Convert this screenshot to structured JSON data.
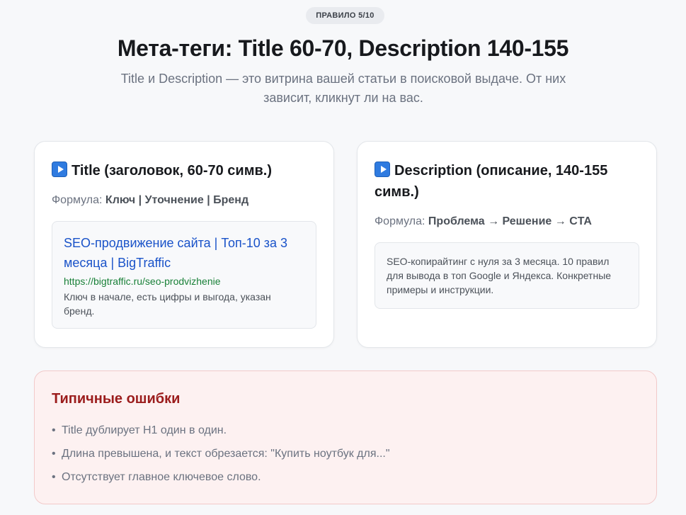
{
  "badge": "ПРАВИЛО 5/10",
  "header": {
    "title": "Мета-теги: Title 60-70, Description 140-155",
    "subtitle": "Title и Description — это витрина вашей статьи в поисковой выдаче. От них зависит, кликнут ли на вас."
  },
  "title_card": {
    "icon": "play-icon",
    "heading": "Title (заголовок, 60-70 симв.)",
    "formula_label": "Формула:",
    "formula_value": "Ключ | Уточнение | Бренд",
    "serp": {
      "title": "SEO-продвижение сайта | Топ-10 за 3 месяца | BigTraffic",
      "url": "https://bigtraffic.ru/seo-prodvizhenie",
      "note": "Ключ в начале, есть цифры и выгода, указан бренд."
    }
  },
  "description_card": {
    "icon": "play-icon",
    "heading": "Description (описание, 140-155 симв.)",
    "formula_label": "Формула:",
    "formula_value": "Проблема → Решение → CTA",
    "example": "SEO-копирайтинг с нуля за 3 месяца. 10 правил для вывода в топ Google и Яндекса. Конкретные примеры и инструкции."
  },
  "errors": {
    "title": "Типичные ошибки",
    "items": [
      "Title дублирует H1 один в один.",
      "Длина превышена, и текст обрезается: \"Купить ноутбук для...\"",
      "Отсутствует главное ключевое слово."
    ]
  },
  "colors": {
    "accent_link": "#1a53c9",
    "url_green": "#198038",
    "error_red": "#9b1c1c",
    "error_bg": "#fdf1f1"
  }
}
